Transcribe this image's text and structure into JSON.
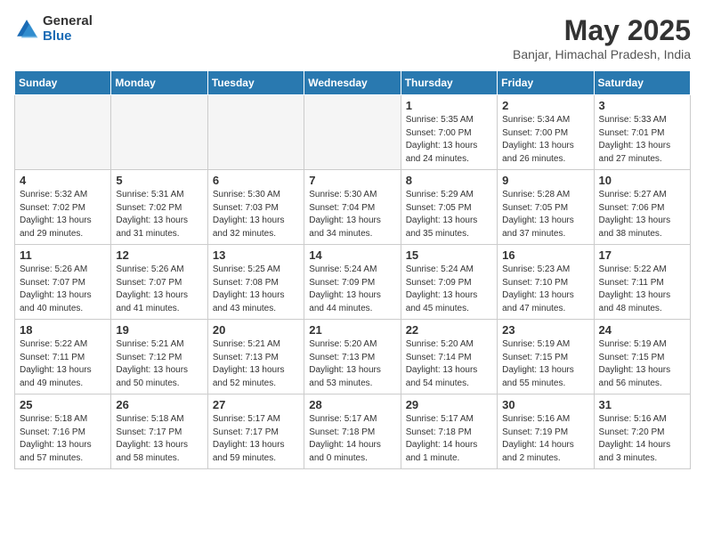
{
  "logo": {
    "general": "General",
    "blue": "Blue"
  },
  "title": "May 2025",
  "subtitle": "Banjar, Himachal Pradesh, India",
  "days_of_week": [
    "Sunday",
    "Monday",
    "Tuesday",
    "Wednesday",
    "Thursday",
    "Friday",
    "Saturday"
  ],
  "weeks": [
    [
      {
        "num": "",
        "detail": ""
      },
      {
        "num": "",
        "detail": ""
      },
      {
        "num": "",
        "detail": ""
      },
      {
        "num": "",
        "detail": ""
      },
      {
        "num": "1",
        "detail": "Sunrise: 5:35 AM\nSunset: 7:00 PM\nDaylight: 13 hours\nand 24 minutes."
      },
      {
        "num": "2",
        "detail": "Sunrise: 5:34 AM\nSunset: 7:00 PM\nDaylight: 13 hours\nand 26 minutes."
      },
      {
        "num": "3",
        "detail": "Sunrise: 5:33 AM\nSunset: 7:01 PM\nDaylight: 13 hours\nand 27 minutes."
      }
    ],
    [
      {
        "num": "4",
        "detail": "Sunrise: 5:32 AM\nSunset: 7:02 PM\nDaylight: 13 hours\nand 29 minutes."
      },
      {
        "num": "5",
        "detail": "Sunrise: 5:31 AM\nSunset: 7:02 PM\nDaylight: 13 hours\nand 31 minutes."
      },
      {
        "num": "6",
        "detail": "Sunrise: 5:30 AM\nSunset: 7:03 PM\nDaylight: 13 hours\nand 32 minutes."
      },
      {
        "num": "7",
        "detail": "Sunrise: 5:30 AM\nSunset: 7:04 PM\nDaylight: 13 hours\nand 34 minutes."
      },
      {
        "num": "8",
        "detail": "Sunrise: 5:29 AM\nSunset: 7:05 PM\nDaylight: 13 hours\nand 35 minutes."
      },
      {
        "num": "9",
        "detail": "Sunrise: 5:28 AM\nSunset: 7:05 PM\nDaylight: 13 hours\nand 37 minutes."
      },
      {
        "num": "10",
        "detail": "Sunrise: 5:27 AM\nSunset: 7:06 PM\nDaylight: 13 hours\nand 38 minutes."
      }
    ],
    [
      {
        "num": "11",
        "detail": "Sunrise: 5:26 AM\nSunset: 7:07 PM\nDaylight: 13 hours\nand 40 minutes."
      },
      {
        "num": "12",
        "detail": "Sunrise: 5:26 AM\nSunset: 7:07 PM\nDaylight: 13 hours\nand 41 minutes."
      },
      {
        "num": "13",
        "detail": "Sunrise: 5:25 AM\nSunset: 7:08 PM\nDaylight: 13 hours\nand 43 minutes."
      },
      {
        "num": "14",
        "detail": "Sunrise: 5:24 AM\nSunset: 7:09 PM\nDaylight: 13 hours\nand 44 minutes."
      },
      {
        "num": "15",
        "detail": "Sunrise: 5:24 AM\nSunset: 7:09 PM\nDaylight: 13 hours\nand 45 minutes."
      },
      {
        "num": "16",
        "detail": "Sunrise: 5:23 AM\nSunset: 7:10 PM\nDaylight: 13 hours\nand 47 minutes."
      },
      {
        "num": "17",
        "detail": "Sunrise: 5:22 AM\nSunset: 7:11 PM\nDaylight: 13 hours\nand 48 minutes."
      }
    ],
    [
      {
        "num": "18",
        "detail": "Sunrise: 5:22 AM\nSunset: 7:11 PM\nDaylight: 13 hours\nand 49 minutes."
      },
      {
        "num": "19",
        "detail": "Sunrise: 5:21 AM\nSunset: 7:12 PM\nDaylight: 13 hours\nand 50 minutes."
      },
      {
        "num": "20",
        "detail": "Sunrise: 5:21 AM\nSunset: 7:13 PM\nDaylight: 13 hours\nand 52 minutes."
      },
      {
        "num": "21",
        "detail": "Sunrise: 5:20 AM\nSunset: 7:13 PM\nDaylight: 13 hours\nand 53 minutes."
      },
      {
        "num": "22",
        "detail": "Sunrise: 5:20 AM\nSunset: 7:14 PM\nDaylight: 13 hours\nand 54 minutes."
      },
      {
        "num": "23",
        "detail": "Sunrise: 5:19 AM\nSunset: 7:15 PM\nDaylight: 13 hours\nand 55 minutes."
      },
      {
        "num": "24",
        "detail": "Sunrise: 5:19 AM\nSunset: 7:15 PM\nDaylight: 13 hours\nand 56 minutes."
      }
    ],
    [
      {
        "num": "25",
        "detail": "Sunrise: 5:18 AM\nSunset: 7:16 PM\nDaylight: 13 hours\nand 57 minutes."
      },
      {
        "num": "26",
        "detail": "Sunrise: 5:18 AM\nSunset: 7:17 PM\nDaylight: 13 hours\nand 58 minutes."
      },
      {
        "num": "27",
        "detail": "Sunrise: 5:17 AM\nSunset: 7:17 PM\nDaylight: 13 hours\nand 59 minutes."
      },
      {
        "num": "28",
        "detail": "Sunrise: 5:17 AM\nSunset: 7:18 PM\nDaylight: 14 hours\nand 0 minutes."
      },
      {
        "num": "29",
        "detail": "Sunrise: 5:17 AM\nSunset: 7:18 PM\nDaylight: 14 hours\nand 1 minute."
      },
      {
        "num": "30",
        "detail": "Sunrise: 5:16 AM\nSunset: 7:19 PM\nDaylight: 14 hours\nand 2 minutes."
      },
      {
        "num": "31",
        "detail": "Sunrise: 5:16 AM\nSunset: 7:20 PM\nDaylight: 14 hours\nand 3 minutes."
      }
    ]
  ]
}
